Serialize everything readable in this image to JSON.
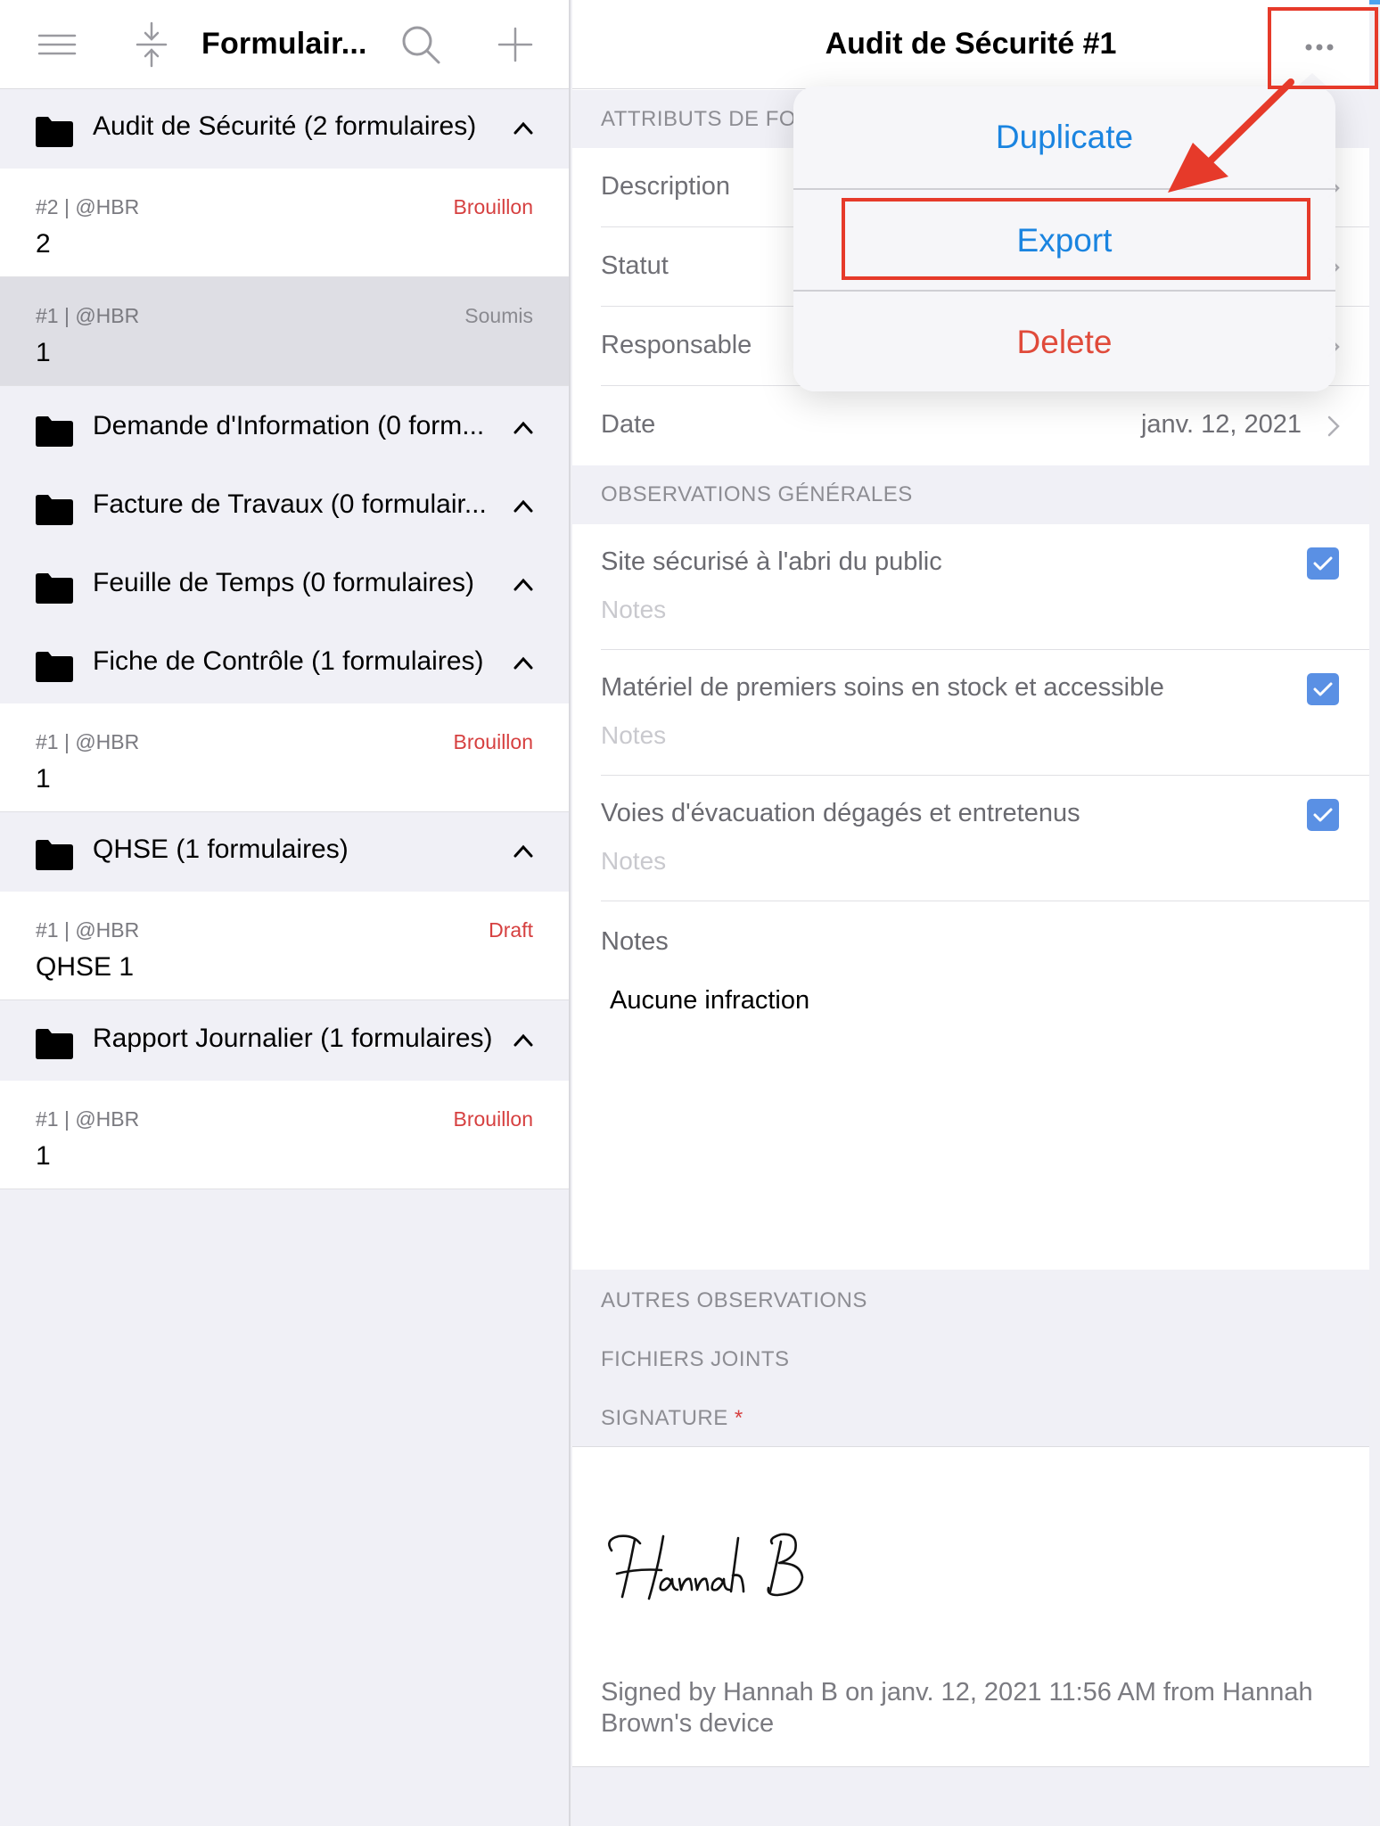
{
  "left_header": {
    "title": "Formulair...",
    "icons": [
      "hamburger-menu-icon",
      "collapse-icon",
      "search-icon",
      "plus-icon"
    ]
  },
  "groups": [
    {
      "label": "Audit de Sécurité (2 formulaires)",
      "forms": [
        {
          "meta": "#2 | @HBR",
          "value": "2",
          "status": "Brouillon"
        },
        {
          "meta": "#1 | @HBR",
          "value": "1",
          "status": "Soumis"
        }
      ]
    },
    {
      "label": "Demande d'Information (0 form...",
      "forms": []
    },
    {
      "label": "Facture de Travaux (0 formulair...",
      "forms": []
    },
    {
      "label": "Feuille de Temps (0 formulaires)",
      "forms": []
    },
    {
      "label": "Fiche de Contrôle (1 formulaires)",
      "forms": [
        {
          "meta": "#1 | @HBR",
          "value": "1",
          "status": "Brouillon"
        }
      ]
    },
    {
      "label": "QHSE (1 formulaires)",
      "forms": [
        {
          "meta": "#1 | @HBR",
          "value": "QHSE 1",
          "status": "Draft"
        }
      ]
    },
    {
      "label": "Rapport Journalier (1 formulaires)",
      "forms": [
        {
          "meta": "#1 | @HBR",
          "value": "1",
          "status": "Brouillon"
        }
      ]
    }
  ],
  "detail": {
    "title": "Audit de Sécurité #1",
    "section_attributes": "ATTRIBUTS DE FO",
    "attributes": [
      {
        "label": "Description",
        "value": ""
      },
      {
        "label": "Statut",
        "value": ""
      },
      {
        "label": "Responsable",
        "value": ""
      },
      {
        "label": "Date",
        "value": "janv. 12, 2021"
      }
    ],
    "section_observations": "OBSERVATIONS GÉNÉRALES",
    "checks": [
      {
        "label": "Site sécurisé à l'abri du public",
        "notes_placeholder": "Notes",
        "checked": true
      },
      {
        "label": "Matériel de premiers soins en stock et accessible",
        "notes_placeholder": "Notes",
        "checked": true
      },
      {
        "label": "Voies d'évacuation dégagés et entretenus",
        "notes_placeholder": "Notes",
        "checked": true
      }
    ],
    "notes_label": "Notes",
    "notes_value": "Aucune infraction",
    "section_other": "AUTRES OBSERVATIONS",
    "section_files": "FICHIERS JOINTS",
    "section_signature": "SIGNATURE",
    "required_mark": "*",
    "signature_name": "Hannah B",
    "signature_text": "Signed by Hannah B on janv. 12, 2021 11:56 AM from Hannah Brown's device"
  },
  "menu": {
    "duplicate": "Duplicate",
    "export": "Export",
    "delete": "Delete"
  },
  "colors": {
    "accent_blue": "#1a84e0",
    "status_red": "#d64040",
    "checkbox_blue": "#5a90e4",
    "annotation_red": "#e63a2a"
  }
}
